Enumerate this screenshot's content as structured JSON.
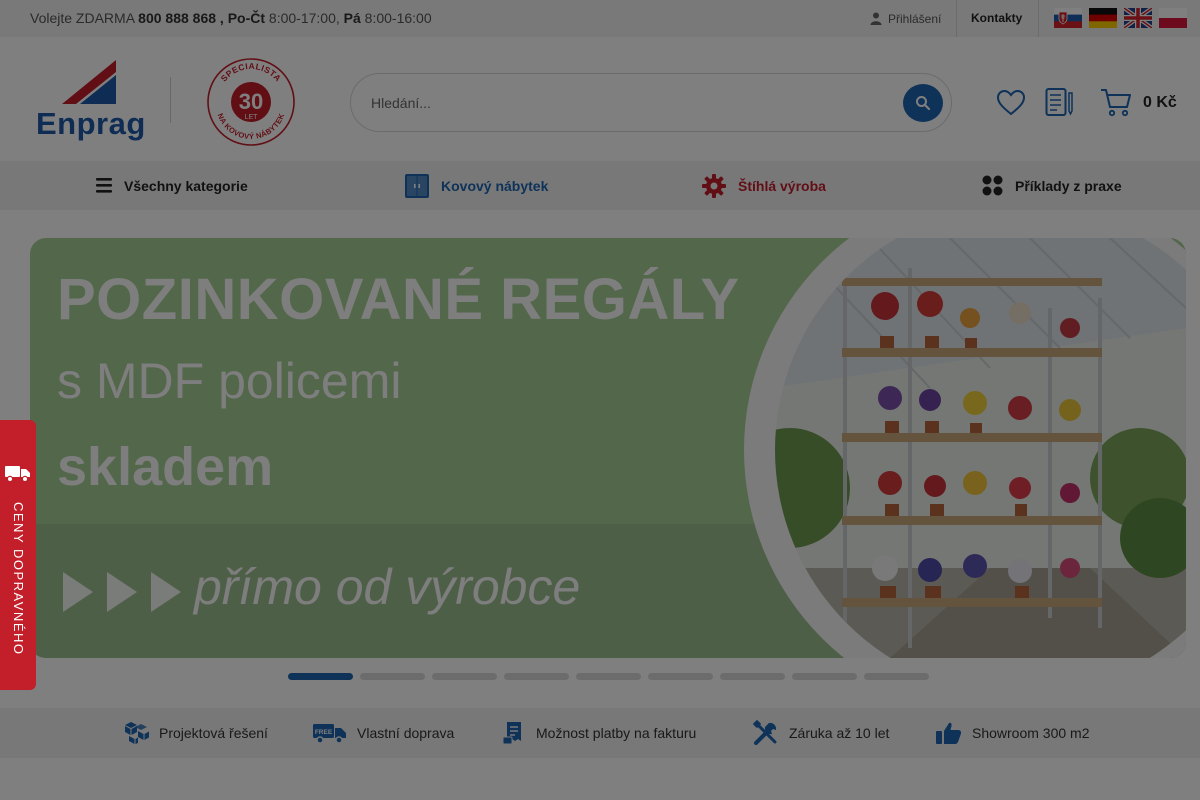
{
  "colors": {
    "brand_blue": "#1d64b0",
    "brand_red": "#c21f2b",
    "banner_green": "#a6cf97",
    "overlay": "rgba(0,0,0,0.5)"
  },
  "topbar": {
    "prefix": "Volejte ZDARMA",
    "phone": "800 888 868",
    "comma": " ,",
    "weekdays_label": "Po-Čt",
    "weekdays_hours": "8:00-17:00,",
    "friday_label": "Pá",
    "friday_hours": "8:00-16:00",
    "login_label": "Přihlášení",
    "login_icon": "user-icon",
    "contacts_label": "Kontakty",
    "flags": [
      "flag-sk-icon",
      "flag-de-icon",
      "flag-gb-icon",
      "flag-pl-icon"
    ]
  },
  "header": {
    "logo_text": "Enprag",
    "badge_number": "30",
    "badge_unit": "LET",
    "badge_arc_top": "SPECIALISTA",
    "badge_arc_bottom": "NA KOVOVÝ NÁBYTEK",
    "search_placeholder": "Hledání...",
    "search_icon": "search-icon",
    "wishlist_icon": "heart-icon",
    "compare_icon": "list-icon",
    "cart_icon": "cart-icon",
    "cart_total": "0 Kč"
  },
  "nav": {
    "items": [
      {
        "label": "Všechny kategorie",
        "icon": "hamburger-icon",
        "color": "#222222"
      },
      {
        "label": "Kovový nábytek",
        "icon": "cabinet-icon",
        "color": "#1d64b0"
      },
      {
        "label": "Štíhlá výroba",
        "icon": "gear-icon",
        "color": "#c21f2b"
      },
      {
        "label": "Příklady z praxe",
        "icon": "grid-icon",
        "color": "#222222"
      }
    ]
  },
  "banner": {
    "title": "POZINKOVANÉ REGÁLY",
    "subtitle": "s MDF policemi",
    "stock": "skladem",
    "direct": "přímo od výrobce"
  },
  "slider": {
    "count": 9,
    "active_index": 0
  },
  "usp": {
    "items": [
      {
        "label": "Projektová řešení",
        "icon": "cubes-icon"
      },
      {
        "label": "Vlastní doprava",
        "icon": "truck-icon"
      },
      {
        "label": "Možnost platby na fakturu",
        "icon": "invoice-icon"
      },
      {
        "label": "Záruka až 10 let",
        "icon": "tools-icon"
      },
      {
        "label": "Showroom 300 m2",
        "icon": "thumbs-up-icon"
      }
    ]
  },
  "side_tab": {
    "label": "CENY DOPRAVNÉHO",
    "icon": "truck-icon"
  }
}
